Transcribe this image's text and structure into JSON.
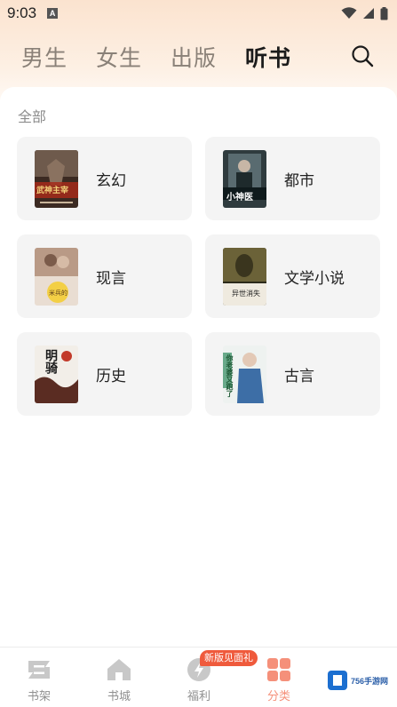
{
  "status_bar": {
    "time": "9:03",
    "notification_letter": "A"
  },
  "top_tabs": [
    {
      "label": "男生",
      "active": false
    },
    {
      "label": "女生",
      "active": false
    },
    {
      "label": "出版",
      "active": false
    },
    {
      "label": "听书",
      "active": true
    }
  ],
  "section": {
    "label": "全部"
  },
  "categories": [
    {
      "label": "玄幻",
      "cover_text": "武神主宰"
    },
    {
      "label": "都市",
      "cover_text": "小神医"
    },
    {
      "label": "现言",
      "cover_text": "米兵的"
    },
    {
      "label": "文学小说",
      "cover_text": "异世消失"
    },
    {
      "label": "历史",
      "cover_text": "明骑"
    },
    {
      "label": "古言",
      "cover_text": "你老婆又跑了"
    }
  ],
  "bottom_nav": {
    "items": [
      {
        "label": "书架",
        "active": false
      },
      {
        "label": "书城",
        "active": false
      },
      {
        "label": "福利",
        "active": false
      },
      {
        "label": "分类",
        "active": true
      }
    ],
    "promo_badge": "新版见面礼"
  },
  "watermark": {
    "text": "756手游网"
  },
  "colors": {
    "accent": "#f5907a",
    "badge": "#ef5a3c",
    "card_bg": "#f4f4f4"
  }
}
